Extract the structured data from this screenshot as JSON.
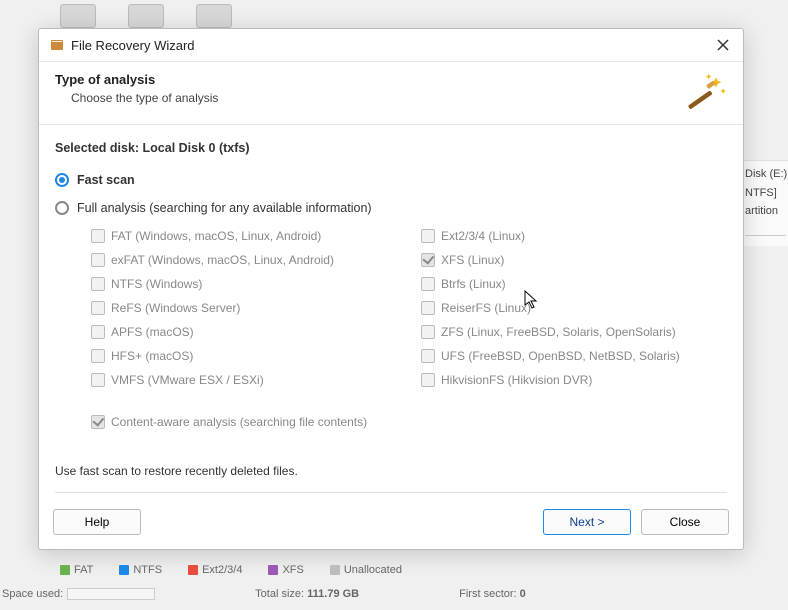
{
  "dialog": {
    "title": "File Recovery Wizard",
    "header_title": "Type of analysis",
    "header_subtitle": "Choose the type of analysis",
    "selected_disk_label": "Selected disk: Local Disk 0 (txfs)",
    "fast_scan_label": "Fast scan",
    "full_analysis_label": "Full analysis (searching for any available information)",
    "content_aware_label": "Content-aware analysis (searching file contents)",
    "footer_note": "Use fast scan to restore recently deleted files.",
    "help_label": "Help",
    "next_label": "Next >",
    "close_label": "Close"
  },
  "filesystems_left": [
    "FAT (Windows, macOS, Linux, Android)",
    "exFAT (Windows, macOS, Linux, Android)",
    "NTFS (Windows)",
    "ReFS (Windows Server)",
    "APFS (macOS)",
    "HFS+ (macOS)",
    "VMFS (VMware ESX / ESXi)"
  ],
  "filesystems_right": [
    "Ext2/3/4 (Linux)",
    "XFS (Linux)",
    "Btrfs (Linux)",
    "ReiserFS (Linux)",
    "ZFS (Linux, FreeBSD, Solaris, OpenSolaris)",
    "UFS (FreeBSD, OpenBSD, NetBSD, Solaris)",
    "HikvisionFS (Hikvision DVR)"
  ],
  "background": {
    "right_panel": [
      "Disk (E:)",
      "NTFS]",
      "artition"
    ],
    "legend": [
      {
        "label": "FAT",
        "color": "#6ab04c"
      },
      {
        "label": "NTFS",
        "color": "#1e88e5"
      },
      {
        "label": "Ext2/3/4",
        "color": "#e74c3c"
      },
      {
        "label": "XFS",
        "color": "#9b59b6"
      },
      {
        "label": "Unallocated",
        "color": "#bdbdbd"
      }
    ],
    "space_used_label": "Space used:",
    "total_size_label": "Total size:",
    "total_size_value": "111.79 GB",
    "first_sector_label": "First sector:",
    "first_sector_value": "0"
  }
}
